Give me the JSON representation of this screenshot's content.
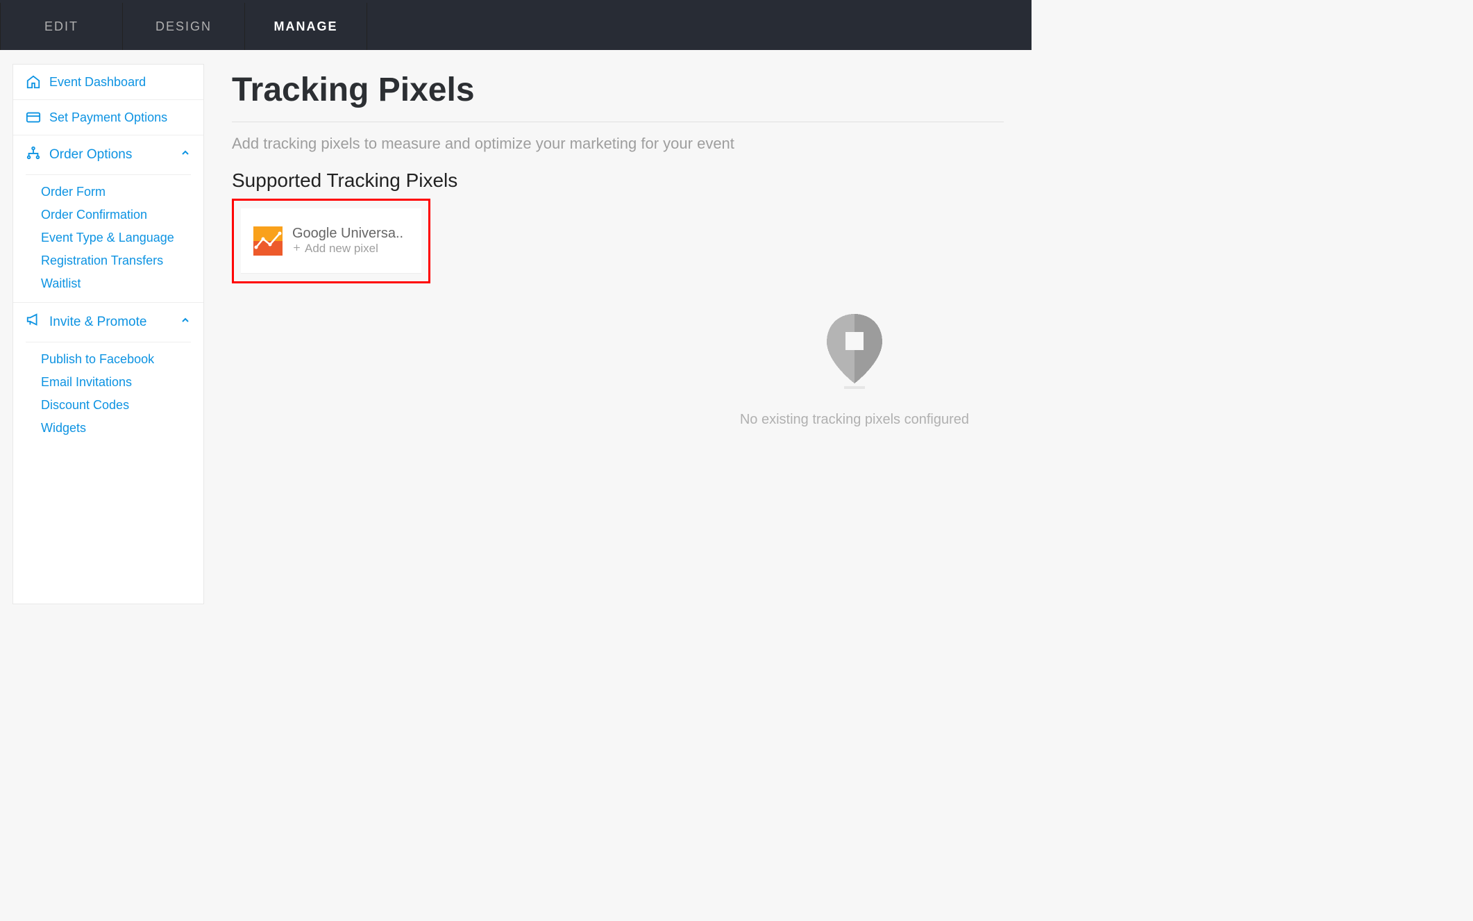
{
  "nav": {
    "tabs": [
      "EDIT",
      "DESIGN",
      "MANAGE"
    ],
    "active": "MANAGE"
  },
  "sidebar": {
    "item_dashboard": "Event Dashboard",
    "item_payment": "Set Payment Options",
    "section_order": {
      "title": "Order Options",
      "items": [
        "Order Form",
        "Order Confirmation",
        "Event Type & Language",
        "Registration Transfers",
        "Waitlist"
      ]
    },
    "section_invite": {
      "title": "Invite & Promote",
      "items": [
        "Publish to Facebook",
        "Email Invitations",
        "Discount Codes",
        "Widgets"
      ]
    }
  },
  "main": {
    "title": "Tracking Pixels",
    "subtitle": "Add tracking pixels to measure and optimize your marketing for your event",
    "section_heading": "Supported Tracking Pixels",
    "pixel_card": {
      "name": "Google Universa..",
      "add_label": "Add new pixel"
    },
    "empty_msg": "No existing tracking pixels configured"
  },
  "colors": {
    "accent": "#0d93e2",
    "highlight_border": "#ff0000",
    "analytics_top": "#f9a11b",
    "analytics_bottom": "#ed5a2b"
  }
}
